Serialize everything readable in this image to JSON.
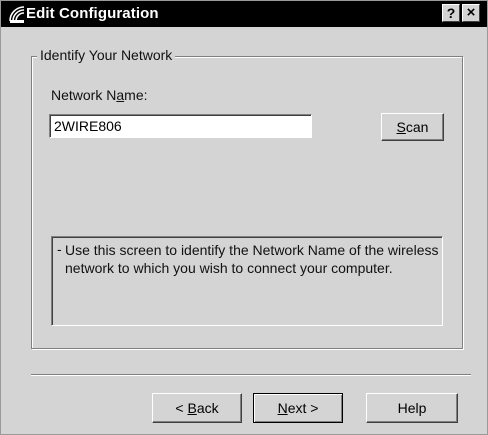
{
  "window": {
    "title": "Edit Configuration",
    "help_glyph": "?",
    "close_glyph": "×"
  },
  "group": {
    "legend": "Identify Your Network"
  },
  "network_name": {
    "label_pre": "Network N",
    "label_mnemonic": "a",
    "label_post": "me:",
    "value": "2WIRE806"
  },
  "scan_button": {
    "mnemonic": "S",
    "rest": "can"
  },
  "info": {
    "dash": "-",
    "text": "Use this screen to identify the Network Name of the wireless network to which you wish to connect your computer."
  },
  "buttons": {
    "back_prefix": "< ",
    "back_mnemonic": "B",
    "back_rest": "ack",
    "next_mnemonic": "N",
    "next_rest": "ext >",
    "help": "Help"
  }
}
